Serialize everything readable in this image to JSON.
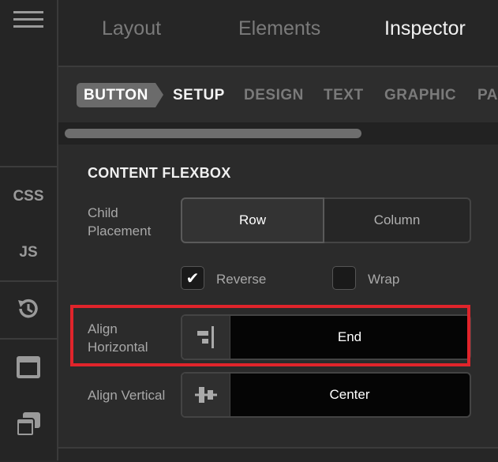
{
  "rail": {
    "css_label": "CSS",
    "js_label": "JS"
  },
  "tabs": [
    "Layout",
    "Elements",
    "Inspector"
  ],
  "breadcrumb": [
    "BUTTON",
    "SETUP",
    "DESIGN",
    "TEXT",
    "GRAPHIC",
    "PA"
  ],
  "section": {
    "title": "CONTENT FLEXBOX",
    "child_placement_label": [
      "Child",
      "Placement"
    ],
    "placement_options": [
      "Row",
      "Column"
    ],
    "selected_placement": "Row",
    "reverse_label": "Reverse",
    "reverse_checked": true,
    "wrap_label": "Wrap",
    "wrap_checked": false,
    "align_horizontal_label": [
      "Align",
      "Horizontal"
    ],
    "align_horizontal_value": "End",
    "align_vertical_label": "Align Vertical",
    "align_vertical_value": "Center"
  },
  "colors": {
    "highlight": "#e0242b",
    "accent_pill": "#6b6b6b"
  }
}
